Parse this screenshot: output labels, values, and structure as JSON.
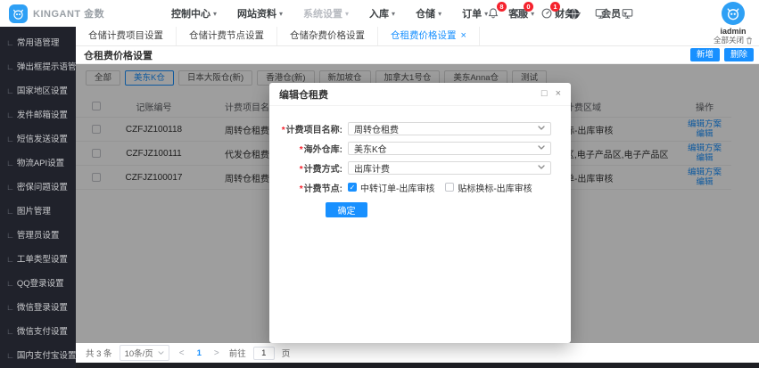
{
  "brand": {
    "name": "KINGANT 金数"
  },
  "topnav": {
    "menus": [
      {
        "label": "控制中心",
        "muted": false
      },
      {
        "label": "网站资料",
        "muted": false
      },
      {
        "label": "系统设置",
        "muted": true
      },
      {
        "label": "入库",
        "muted": false
      },
      {
        "label": "仓储",
        "muted": false
      },
      {
        "label": "订单",
        "muted": false
      },
      {
        "label": "客服",
        "muted": false
      },
      {
        "label": "财务",
        "muted": false
      },
      {
        "label": "会员",
        "muted": false
      }
    ]
  },
  "topbar_icons": [
    {
      "name": "bell-icon",
      "badge": "8"
    },
    {
      "name": "message-icon",
      "badge": "0"
    },
    {
      "name": "dashboard-icon",
      "badge": "1"
    },
    {
      "name": "globe-icon"
    },
    {
      "name": "monitor-icon"
    },
    {
      "name": "monitor-icon-2"
    }
  ],
  "user": {
    "name": "iadmin",
    "close_all_label": "全部关闭"
  },
  "sidebar": {
    "items": [
      "常用语管理",
      "弹出框提示语管理",
      "国家地区设置",
      "发件邮箱设置",
      "短信发送设置",
      "物流API设置",
      "密保问题设置",
      "图片管理",
      "管理员设置",
      "工单类型设置",
      "QQ登录设置",
      "微信登录设置",
      "微信支付设置",
      "国内支付宝设置"
    ]
  },
  "tabs": {
    "items": [
      {
        "label": "仓储计费项目设置",
        "active": false,
        "closable": false
      },
      {
        "label": "仓储计费节点设置",
        "active": false,
        "closable": false
      },
      {
        "label": "仓储杂费价格设置",
        "active": false,
        "closable": false
      },
      {
        "label": "仓租费价格设置",
        "active": true,
        "closable": true
      }
    ]
  },
  "page": {
    "title": "仓租费价格设置",
    "buttons": {
      "add": "新增",
      "delete": "删除"
    }
  },
  "filters": {
    "selected_index": 1,
    "items": [
      "全部",
      "美东K仓",
      "日本大阪仓(新)",
      "香港仓(新)",
      "新加坡仓",
      "加拿大1号仓",
      "美东Anna仓",
      "测试"
    ]
  },
  "table": {
    "headers": [
      "记账编号",
      "计费项目名称",
      "计费区域",
      "操作"
    ],
    "action_labels": [
      "编辑方案",
      "编辑"
    ],
    "rows": [
      {
        "id": "CZFJZ100118",
        "name": "周转仓租费",
        "region_visible": "标-出库审核"
      },
      {
        "id": "CZFJZ100111",
        "name": "代发仓租费",
        "region_visible": "区,电子产品区,电子产品区"
      },
      {
        "id": "CZFJZ100017",
        "name": "周转仓租费",
        "region_visible": "单-出库审核"
      }
    ]
  },
  "pagination": {
    "total": "共 3 条",
    "page_size": "10条/页",
    "current_page": "1",
    "goto_label": "前往",
    "goto_value": "1",
    "page_unit": "页"
  },
  "modal": {
    "title": "编辑仓租费",
    "fields": [
      {
        "label": "计费项目名称",
        "required": true,
        "type": "select",
        "value": "周转仓租费"
      },
      {
        "label": "海外仓库",
        "required": true,
        "type": "select",
        "value": "美东K仓"
      },
      {
        "label": "计费方式",
        "required": true,
        "type": "select",
        "value": "出库计费"
      },
      {
        "label": "计费节点",
        "required": true,
        "type": "checkbox-group",
        "options": [
          {
            "label": "中转订单-出库审核",
            "checked": true
          },
          {
            "label": "贴标换标-出库审核",
            "checked": false
          }
        ]
      }
    ],
    "confirm_label": "确定"
  },
  "colors": {
    "primary": "#1890ff",
    "sidebar_bg": "#20222b",
    "badge_red": "#f5222d",
    "brand_blue": "#2ea0f5"
  }
}
